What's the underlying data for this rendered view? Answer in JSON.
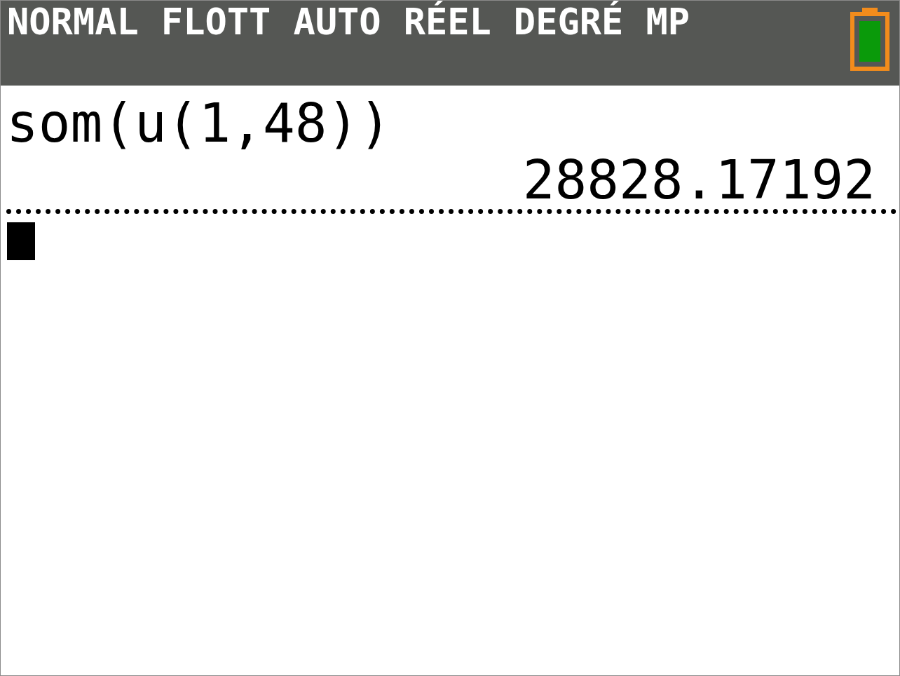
{
  "status_bar": {
    "modes": [
      "NORMAL",
      "FLOTT",
      "AUTO",
      "RÉEL",
      "DEGRÉ",
      "MP"
    ]
  },
  "history": [
    {
      "expression": "som(u(1,48))",
      "result": "28828.17192"
    }
  ]
}
